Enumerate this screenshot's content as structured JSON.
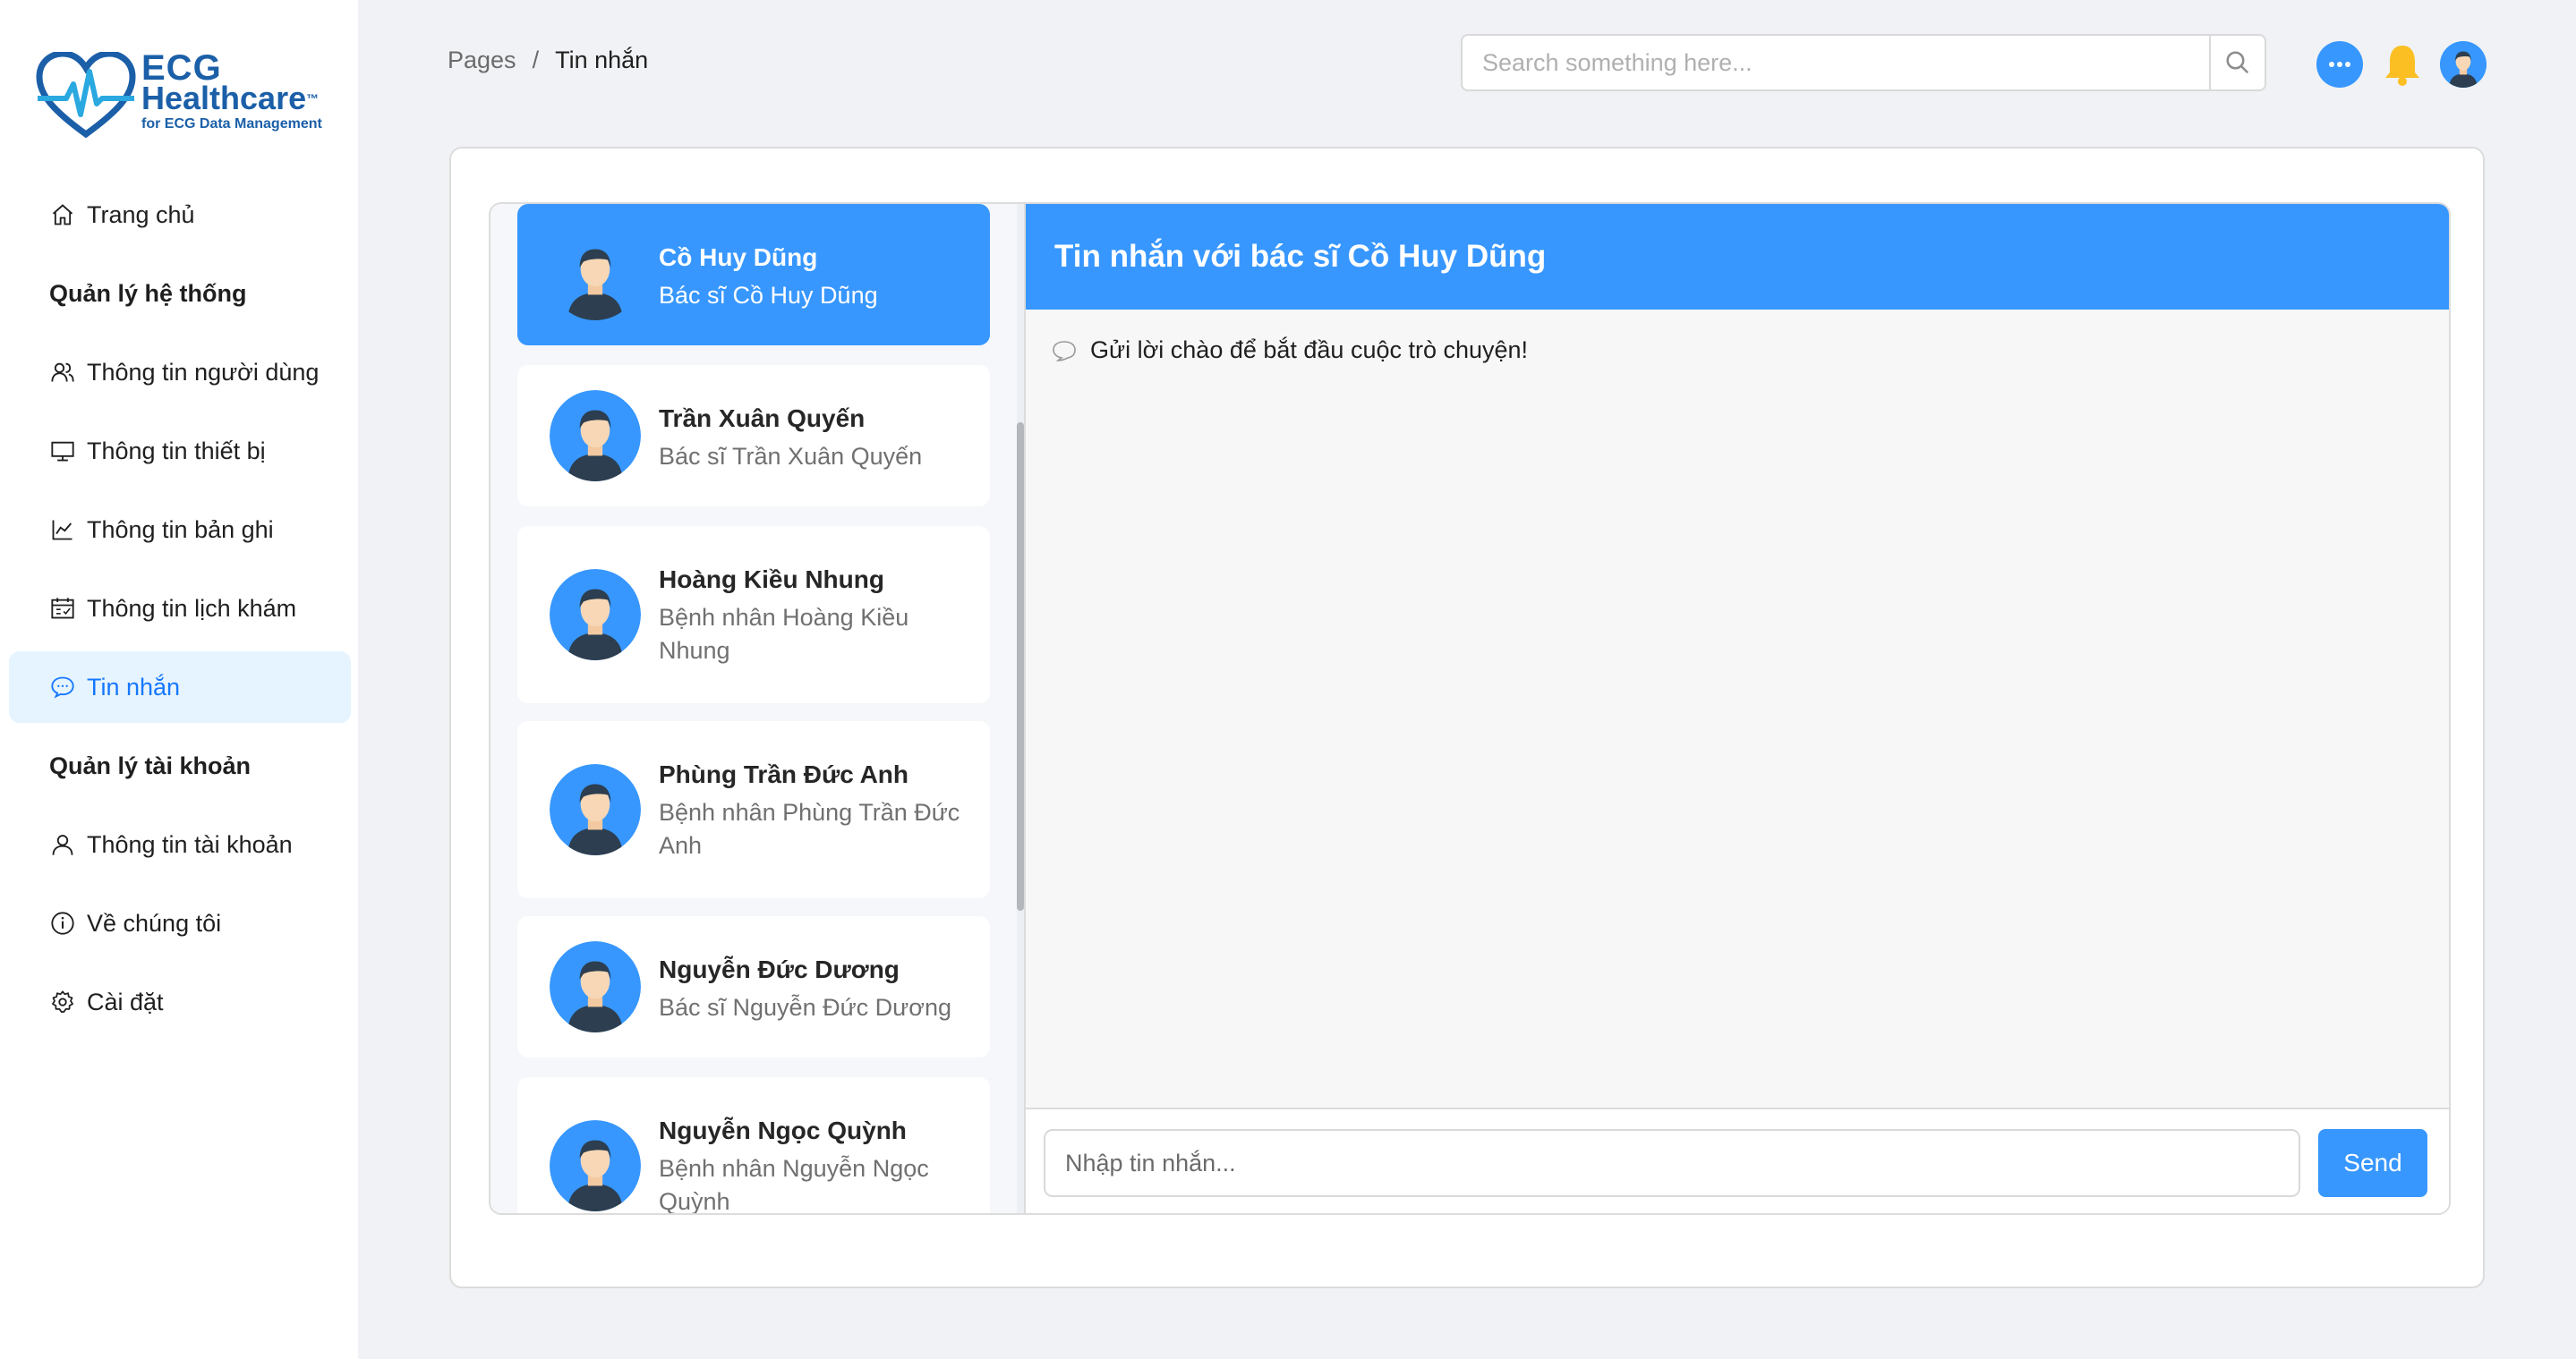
{
  "logo": {
    "line1": "ECG",
    "line2": "Healthcare",
    "tm": "™",
    "tagline": "for ECG Data Management"
  },
  "sidebar": {
    "items": [
      {
        "type": "item",
        "label": "Trang chủ",
        "icon": "home-icon"
      },
      {
        "type": "group",
        "label": "Quản lý hệ thống"
      },
      {
        "type": "item",
        "label": "Thông tin người dùng",
        "icon": "users-icon"
      },
      {
        "type": "item",
        "label": "Thông tin thiết bị",
        "icon": "monitor-icon"
      },
      {
        "type": "item",
        "label": "Thông tin bản ghi",
        "icon": "line-chart-icon"
      },
      {
        "type": "item",
        "label": "Thông tin lịch khám",
        "icon": "schedule-icon"
      },
      {
        "type": "item",
        "label": "Tin nhắn",
        "icon": "message-icon",
        "active": true
      },
      {
        "type": "group",
        "label": "Quản lý tài khoản"
      },
      {
        "type": "item",
        "label": "Thông tin tài khoản",
        "icon": "user-icon"
      },
      {
        "type": "item",
        "label": "Về chúng tôi",
        "icon": "info-icon"
      },
      {
        "type": "item",
        "label": "Cài đặt",
        "icon": "settings-icon"
      }
    ]
  },
  "header": {
    "breadcrumb": {
      "root": "Pages",
      "separator": "/",
      "current": "Tin nhắn"
    },
    "search": {
      "placeholder": "Search something here..."
    },
    "icons": [
      "chat-bubble-icon",
      "bell-icon",
      "avatar"
    ]
  },
  "contacts": [
    {
      "name": "Cồ Huy Dũng",
      "role": "Bác sĩ Cồ Huy Dũng",
      "active": true
    },
    {
      "name": "Trần Xuân Quyến",
      "role": "Bác sĩ Trần Xuân Quyến"
    },
    {
      "name": "Hoàng Kiều Nhung",
      "role": "Bệnh nhân Hoàng Kiều Nhung"
    },
    {
      "name": "Phùng Trần Đức Anh",
      "role": "Bệnh nhân Phùng Trần Đức Anh"
    },
    {
      "name": "Nguyễn Đức Dương",
      "role": "Bác sĩ Nguyễn Đức Dương"
    },
    {
      "name": "Nguyễn Ngọc Quỳnh",
      "role": "Bệnh nhân Nguyễn Ngọc Quỳnh"
    }
  ],
  "chat": {
    "title": "Tin nhắn với bác sĩ Cồ Huy Dũng",
    "empty_message": "Gửi lời chào để bắt đầu cuộc trò chuyện!",
    "input_placeholder": "Nhập tin nhắn...",
    "send_label": "Send"
  },
  "colors": {
    "accent": "#3797ff",
    "active_nav_bg": "#e6f4ff",
    "brand": "#1b5fa8",
    "bell": "#fbbf24"
  }
}
